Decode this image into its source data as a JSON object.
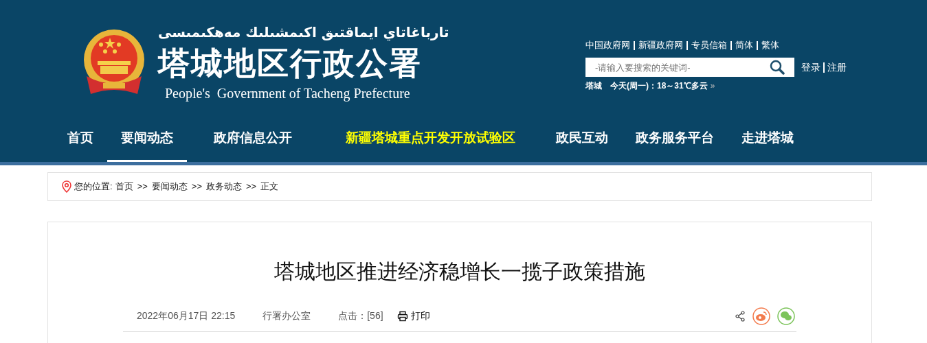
{
  "header": {
    "uyghur_name": "تارباغاتاي ايماقتىق اكىمشىلىك مەھكىمىسى",
    "site_name": "塔城地区行政公署",
    "english_name": "People's  Government of Tacheng Prefecture",
    "top_links": [
      "中国政府网",
      "新疆政府网",
      "专员信箱",
      "简体",
      "繁体"
    ],
    "search": {
      "placeholder": "-请输入要搜索的关键词-"
    },
    "account_links": [
      "登录",
      "注册"
    ],
    "weather": {
      "city": "塔城",
      "forecast": "今天(周一)：18～31℃多云",
      "more": "»"
    }
  },
  "nav": [
    {
      "label": "首页",
      "selected": false,
      "highlighted": false
    },
    {
      "label": "要闻动态",
      "selected": true,
      "highlighted": false
    },
    {
      "label": "政府信息公开",
      "selected": false,
      "highlighted": false
    },
    {
      "label": "新疆塔城重点开发开放试验区",
      "selected": false,
      "highlighted": true
    },
    {
      "label": "政民互动",
      "selected": false,
      "highlighted": false
    },
    {
      "label": "政务服务平台",
      "selected": false,
      "highlighted": false
    },
    {
      "label": "走进塔城",
      "selected": false,
      "highlighted": false
    }
  ],
  "breadcrumb": {
    "label": "您的位置:",
    "items": [
      "首页",
      "要闻动态",
      "政务动态",
      "正文"
    ],
    "separator": ">>"
  },
  "article": {
    "title": "塔城地区推进经济稳增长一揽子政策措施",
    "date": "2022年06月17日 22:15",
    "source": "行署办公室",
    "views": "点击：[56]",
    "print": "打印"
  }
}
